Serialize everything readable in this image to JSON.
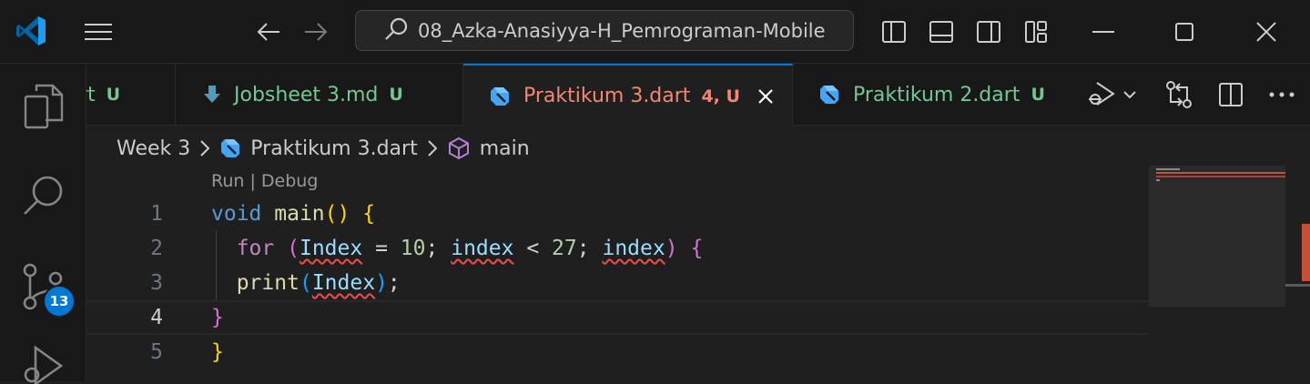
{
  "titlebar": {
    "search_text": "08_Azka-Anasiyya-H_Pemrograman-Mobile"
  },
  "activitybar": {
    "source_control_badge": "13"
  },
  "tabs": [
    {
      "name": "rt",
      "status": "U",
      "icon": "file-icon",
      "state": "untracked"
    },
    {
      "name": "Jobsheet 3.md",
      "status": "U",
      "icon": "markdown-download-icon",
      "state": "untracked"
    },
    {
      "name": "Praktikum 3.dart",
      "status": "4, U",
      "icon": "dart-icon",
      "state": "error",
      "active": true
    },
    {
      "name": "Praktikum 2.dart",
      "status": "U",
      "icon": "dart-icon",
      "state": "untracked"
    }
  ],
  "breadcrumb": {
    "folder": "Week 3",
    "file": "Praktikum 3.dart",
    "symbol": "main"
  },
  "editor": {
    "codelens": "Run | Debug",
    "line_numbers": [
      "1",
      "2",
      "3",
      "4",
      "5"
    ],
    "current_line": "4",
    "tokens": {
      "void": "void",
      "main": "main",
      "paren_open": "(",
      "paren_close": ")",
      "brace_open": "{",
      "for": "for",
      "Index": "Index",
      "eq": "=",
      "ten": "10",
      "semi": ";",
      "index": "index",
      "lt": "<",
      "n27": "27",
      "print": "print",
      "brace_close": "}"
    }
  },
  "colors": {
    "accent": "#0078d4",
    "error": "#f48771",
    "untracked": "#73c991"
  }
}
